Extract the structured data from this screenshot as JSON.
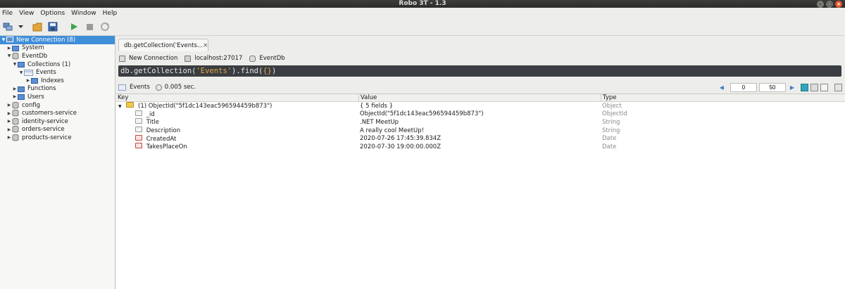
{
  "window": {
    "title": "Robo 3T - 1.3"
  },
  "menu": [
    "File",
    "View",
    "Options",
    "Window",
    "Help"
  ],
  "toolbar": {
    "icons": [
      "connect-icon",
      "dropdown-icon",
      "open-icon",
      "save-icon",
      "run-icon",
      "stop-icon",
      "rotate-icon"
    ]
  },
  "sidebar": {
    "items": [
      {
        "label": "New Connection (8)",
        "depth": 0,
        "expanded": true,
        "icon": "server-icon",
        "selected": true
      },
      {
        "label": "System",
        "depth": 1,
        "expanded": false,
        "icon": "folder-icon"
      },
      {
        "label": "EventDb",
        "depth": 1,
        "expanded": true,
        "icon": "database-icon"
      },
      {
        "label": "Collections (1)",
        "depth": 2,
        "expanded": true,
        "icon": "folder-icon"
      },
      {
        "label": "Events",
        "depth": 3,
        "expanded": true,
        "icon": "collection-icon"
      },
      {
        "label": "Indexes",
        "depth": 4,
        "expanded": false,
        "icon": "folder-icon"
      },
      {
        "label": "Functions",
        "depth": 2,
        "expanded": false,
        "icon": "folder-icon"
      },
      {
        "label": "Users",
        "depth": 2,
        "expanded": false,
        "icon": "folder-icon"
      },
      {
        "label": "config",
        "depth": 1,
        "expanded": false,
        "icon": "database-icon"
      },
      {
        "label": "customers-service",
        "depth": 1,
        "expanded": false,
        "icon": "database-icon"
      },
      {
        "label": "identity-service",
        "depth": 1,
        "expanded": false,
        "icon": "database-icon"
      },
      {
        "label": "orders-service",
        "depth": 1,
        "expanded": false,
        "icon": "database-icon"
      },
      {
        "label": "products-service",
        "depth": 1,
        "expanded": false,
        "icon": "database-icon"
      }
    ]
  },
  "tab": {
    "label": "db.getCollection('Events...",
    "close": "×"
  },
  "info": {
    "connection": "New Connection",
    "host": "localhost:27017",
    "database": "EventDb"
  },
  "query": {
    "prefix": "db.getCollection(",
    "arg": "'Events'",
    "middle": ").find(",
    "obj": "{}",
    "suffix": ")"
  },
  "results": {
    "collection": "Events",
    "time": "0.005 sec.",
    "skip": "0",
    "limit": "50"
  },
  "grid": {
    "headers": {
      "key": "Key",
      "value": "Value",
      "type": "Type"
    },
    "rows": [
      {
        "key": "(1) ObjectId(\"5f1dc143eac596594459b873\")",
        "value": "{ 5 fields }",
        "type": "Object",
        "depth": 0,
        "icon": "object-icon",
        "arrow": "▼"
      },
      {
        "key": "_id",
        "value": "ObjectId(\"5f1dc143eac596594459b873\")",
        "type": "ObjectId",
        "depth": 1,
        "icon": "id-icon",
        "arrow": ""
      },
      {
        "key": "Title",
        "value": ".NET MeetUp",
        "type": "String",
        "depth": 1,
        "icon": "string-icon",
        "arrow": ""
      },
      {
        "key": "Description",
        "value": "A really cool MeetUp!",
        "type": "String",
        "depth": 1,
        "icon": "string-icon",
        "arrow": ""
      },
      {
        "key": "CreatedAt",
        "value": "2020-07-26 17:45:39.834Z",
        "type": "Date",
        "depth": 1,
        "icon": "date-icon",
        "arrow": ""
      },
      {
        "key": "TakesPlaceOn",
        "value": "2020-07-30 19:00:00.000Z",
        "type": "Date",
        "depth": 1,
        "icon": "date-icon",
        "arrow": ""
      }
    ]
  }
}
